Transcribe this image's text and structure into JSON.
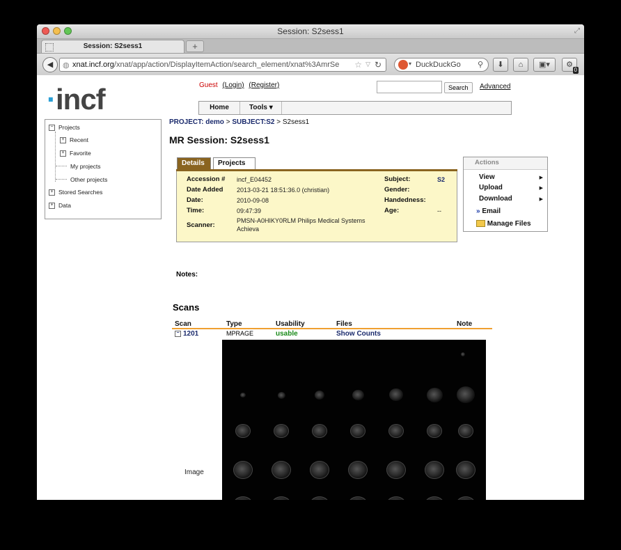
{
  "window": {
    "title": "Session: S2sess1"
  },
  "browser": {
    "tab_label": "Session: S2sess1",
    "new_tab": "+",
    "url_domain": "xnat.incf.org",
    "url_path": "/xnat/app/action/DisplayItemAction/search_element/xnat%3AmrSe",
    "search_engine": "DuckDuckGo",
    "addon_badge": "0"
  },
  "header": {
    "logo": "incf",
    "guest_label": "Guest",
    "login": "(Login)",
    "register": "(Register)",
    "search_button": "Search",
    "advanced_link": "Advanced"
  },
  "menu": {
    "home": "Home",
    "tools": "Tools ▾"
  },
  "sidebar": {
    "items": [
      {
        "label": "Projects"
      },
      {
        "label": "Recent"
      },
      {
        "label": "Favorite"
      },
      {
        "label": "My projects"
      },
      {
        "label": "Other projects"
      },
      {
        "label": "Stored Searches"
      },
      {
        "label": "Data"
      }
    ]
  },
  "breadcrumb": {
    "project": "PROJECT: demo",
    "sep1": ">",
    "subject": "SUBJECT:S2",
    "sep2": ">",
    "session": "S2sess1"
  },
  "session_title": "MR Session: S2sess1",
  "detail_tabs": {
    "details": "Details",
    "projects": "Projects"
  },
  "details": {
    "accession_label": "Accession #",
    "accession_value": "incf_E04452",
    "date_added_label": "Date Added",
    "date_added_value": "2013-03-21 18:51:36.0 (christian)",
    "date_label": "Date:",
    "date_value": "2010-09-08",
    "time_label": "Time:",
    "time_value": "09:47:39",
    "scanner_label": "Scanner:",
    "scanner_value_1": "PMSN-A0HIKY0RLM Philips Medical Systems",
    "scanner_value_2": "Achieva",
    "subject_label": "Subject:",
    "subject_value": "S2",
    "gender_label": "Gender:",
    "handedness_label": "Handedness:",
    "age_label": "Age:",
    "age_value": "--"
  },
  "actions": {
    "header": "Actions",
    "view": "View",
    "upload": "Upload",
    "download": "Download",
    "email": "Email",
    "manage_files": "Manage Files"
  },
  "notes_label": "Notes:",
  "scans": {
    "title": "Scans",
    "headers": [
      "Scan",
      "Type",
      "Usability",
      "Files",
      "Note"
    ],
    "row": {
      "scan": "1201",
      "type": "MPRAGE",
      "usability": "usable",
      "files": "Show Counts"
    },
    "image_label": "Image"
  },
  "colors": {
    "accent_brown": "#8a6420",
    "detail_bg": "#fcf7c8",
    "usable_green": "#1a8a1a",
    "orange_rule": "#f0a030"
  }
}
